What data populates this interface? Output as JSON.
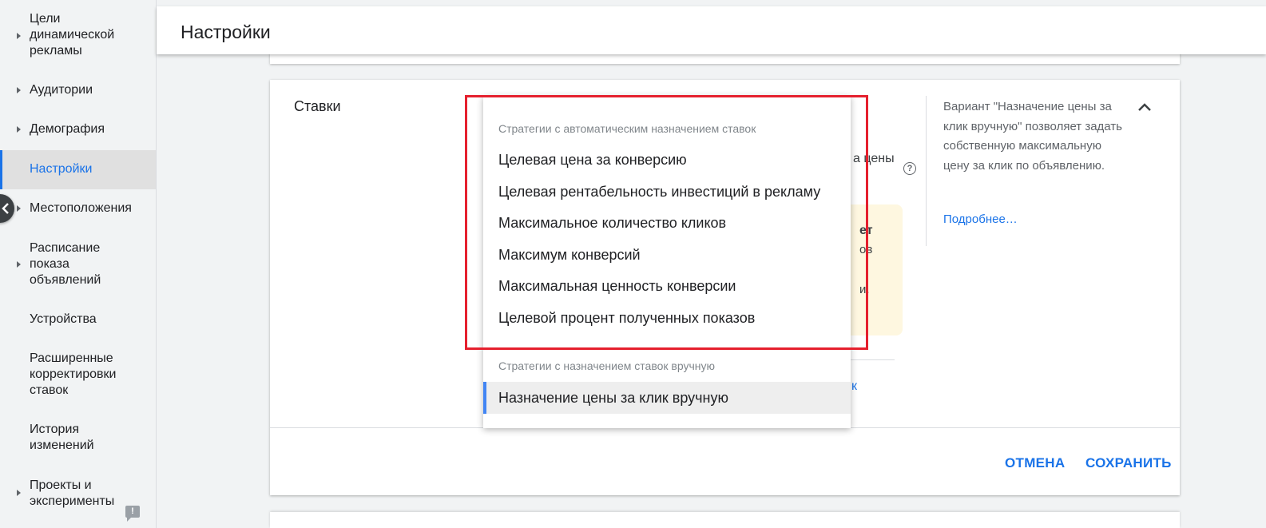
{
  "header": {
    "title": "Настройки"
  },
  "sidebar": {
    "items": [
      {
        "label": "Цели\nдинамической\nрекламы",
        "has_arrow": true
      },
      {
        "label": "Аудитории",
        "has_arrow": true
      },
      {
        "label": "Демография",
        "has_arrow": true
      },
      {
        "label": "Настройки",
        "has_arrow": false,
        "active": true
      },
      {
        "label": "Местоположения",
        "has_arrow": true
      },
      {
        "label": "Расписание\nпоказа\nобъявлений",
        "has_arrow": true
      },
      {
        "label": "Устройства",
        "has_arrow": false
      },
      {
        "label": "Расширенные\nкорректировки\nставок",
        "has_arrow": false
      },
      {
        "label": "История\nизменений",
        "has_arrow": false
      },
      {
        "label": "Проекты и\nэксперименты",
        "has_arrow": true
      }
    ]
  },
  "card": {
    "section_title": "Ставки",
    "help_text": "Вариант \"Назначение цены за клик вручную\" позволяет задать собственную максимальную цену за клик по объявлению.",
    "help_link": "Подробнее…",
    "cancel_label": "ОТМЕНА",
    "save_label": "СОХРАНИТЬ",
    "behind_fragments": [
      "а цены",
      "ет",
      "ов",
      "и.",
      "к"
    ]
  },
  "dropdown": {
    "auto_group_label": "Стратегии с автоматическим назначением ставок",
    "auto_options": [
      "Целевая цена за конверсию",
      "Целевая рентабельность инвестиций в рекламу",
      "Максимальное количество кликов",
      "Максимум конверсий",
      "Максимальная ценность конверсии",
      "Целевой процент полученных показов"
    ],
    "manual_group_label": "Стратегии с назначением ставок вручную",
    "manual_options": [
      "Назначение цены за клик вручную"
    ],
    "selected": "Назначение цены за клик вручную"
  },
  "colors": {
    "accent": "#1a73e8",
    "highlight_frame": "#e5202e",
    "warning_bg": "#fef7e0"
  }
}
